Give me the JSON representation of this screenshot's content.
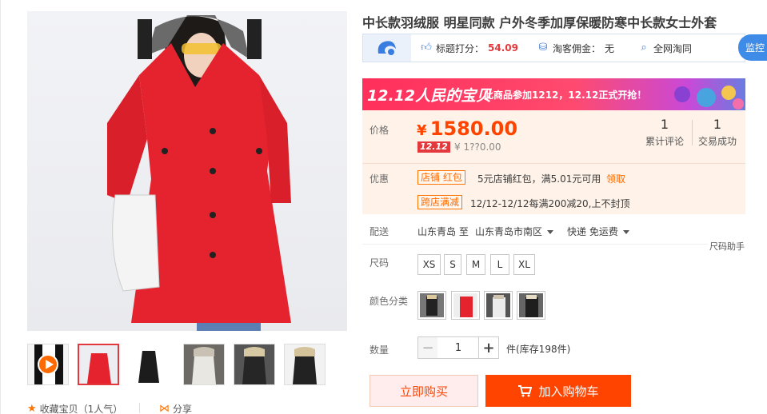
{
  "product": {
    "title": "中长款羽绒服 明星同款 户外冬季加厚保暖防寒中长款女士外套"
  },
  "tool_strip": {
    "score_label": "标题打分：",
    "score_value": "54.09",
    "commission_label": "淘客佣金：",
    "commission_value": "无",
    "search_label": "全网淘同",
    "monitor_button": "监控",
    "icons": [
      "thumbs-up-icon",
      "coin-icon",
      "search-icon"
    ]
  },
  "promo": {
    "logo": "12.12人民的宝贝",
    "text": "此商品参加1212，12.12正式开抢！"
  },
  "price": {
    "label": "价格",
    "currency": "¥",
    "amount": "1580.00",
    "tag": "12.12",
    "preview_price": "¥ 1??0.00",
    "color": "#ff4400"
  },
  "stats": {
    "reviews_value": "1",
    "reviews_label": "累计评论",
    "deals_value": "1",
    "deals_label": "交易成功"
  },
  "offers": {
    "label": "优惠",
    "coupon_badge": "店铺 红包",
    "coupon_text": "5元店铺红包，满5.01元可用",
    "coupon_link": "领取",
    "cross_badge": "跨店满减",
    "cross_text": "12/12-12/12每满200减20,上不封顶"
  },
  "delivery": {
    "label": "配送",
    "from": "山东青岛",
    "to_word": "至",
    "to": "山东青岛市南区",
    "method": "快递 免运费"
  },
  "size": {
    "label": "尺码",
    "assistant": "尺码助手",
    "options": [
      "XS",
      "S",
      "M",
      "L",
      "XL"
    ]
  },
  "color": {
    "label": "颜色分类",
    "options": [
      "black-fur-option",
      "red-option",
      "white-option",
      "black-option"
    ]
  },
  "quantity": {
    "label": "数量",
    "value": "1",
    "minus": "−",
    "plus": "+",
    "stock": "件(库存198件)"
  },
  "actions": {
    "buy_now": "立即购买",
    "add_cart": "加入购物车"
  },
  "footer": {
    "favorite": "收藏宝贝（1人气）",
    "share": "分享"
  }
}
